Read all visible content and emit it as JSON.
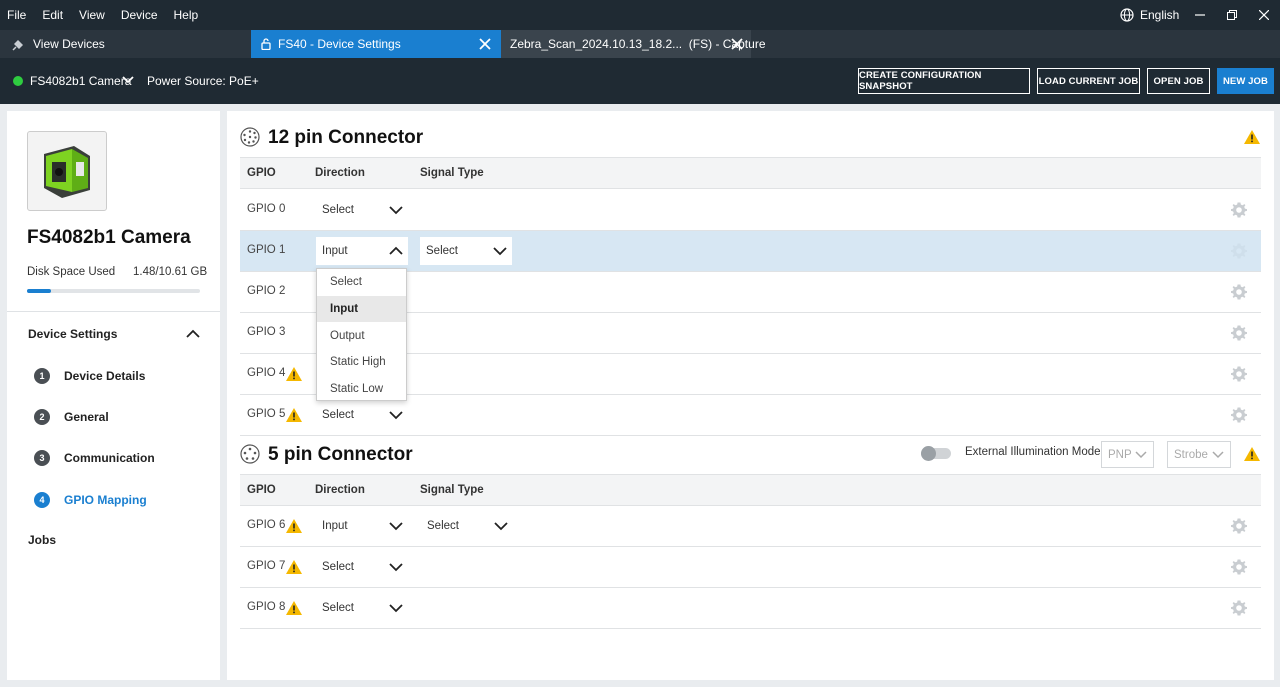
{
  "menu": [
    "File",
    "Edit",
    "View",
    "Device",
    "Help"
  ],
  "language": "English",
  "tabs": {
    "view_devices": "View Devices",
    "device_settings": "FS40 - Device Settings",
    "capture": "Zebra_Scan_2024.10.13_18.2...  (FS) - Capture"
  },
  "device_bar": {
    "device_name": "FS4082b1 Camera",
    "power_source": "Power Source: PoE+",
    "buttons": {
      "snapshot": "CREATE CONFIGURATION SNAPSHOT",
      "load_job": "LOAD CURRENT JOB",
      "open_job": "OPEN JOB",
      "new_job": "NEW JOB"
    },
    "status_color": "#2ecc40"
  },
  "sidebar": {
    "camera_title": "FS4082b1 Camera",
    "disk_label": "Disk Space Used",
    "disk_value": "1.48/10.61 GB",
    "disk_fraction": 0.1395,
    "section_title": "Device Settings",
    "items": [
      {
        "num": "1",
        "label": "Device Details"
      },
      {
        "num": "2",
        "label": "General"
      },
      {
        "num": "3",
        "label": "Communication"
      },
      {
        "num": "4",
        "label": "GPIO Mapping"
      }
    ],
    "jobs": "Jobs"
  },
  "connector12": {
    "title": "12 pin Connector",
    "headers": {
      "gpio": "GPIO",
      "direction": "Direction",
      "signal": "Signal Type"
    },
    "rows": [
      {
        "gpio": "GPIO 0",
        "direction": "Select"
      },
      {
        "gpio": "GPIO 1",
        "direction": "Input",
        "signal": "Select"
      },
      {
        "gpio": "GPIO 2"
      },
      {
        "gpio": "GPIO 3"
      },
      {
        "gpio": "GPIO 4"
      },
      {
        "gpio": "GPIO 5",
        "direction": "Select"
      }
    ]
  },
  "dropdown": {
    "options": [
      "Select",
      "Input",
      "Output",
      "Static High",
      "Static Low"
    ],
    "highlighted": "Input"
  },
  "connector5": {
    "title": "5 pin Connector",
    "ext_label": "External Illumination Mode",
    "pnp": "PNP",
    "strobe": "Strobe",
    "headers": {
      "gpio": "GPIO",
      "direction": "Direction",
      "signal": "Signal Type"
    },
    "rows": [
      {
        "gpio": "GPIO 6",
        "direction": "Input",
        "signal": "Select"
      },
      {
        "gpio": "GPIO 7",
        "direction": "Select"
      },
      {
        "gpio": "GPIO 8",
        "direction": "Select"
      }
    ]
  },
  "colors": {
    "accent": "#1a7fd0",
    "warning": "#f5b800",
    "dark_bar": "#1f2a33"
  }
}
